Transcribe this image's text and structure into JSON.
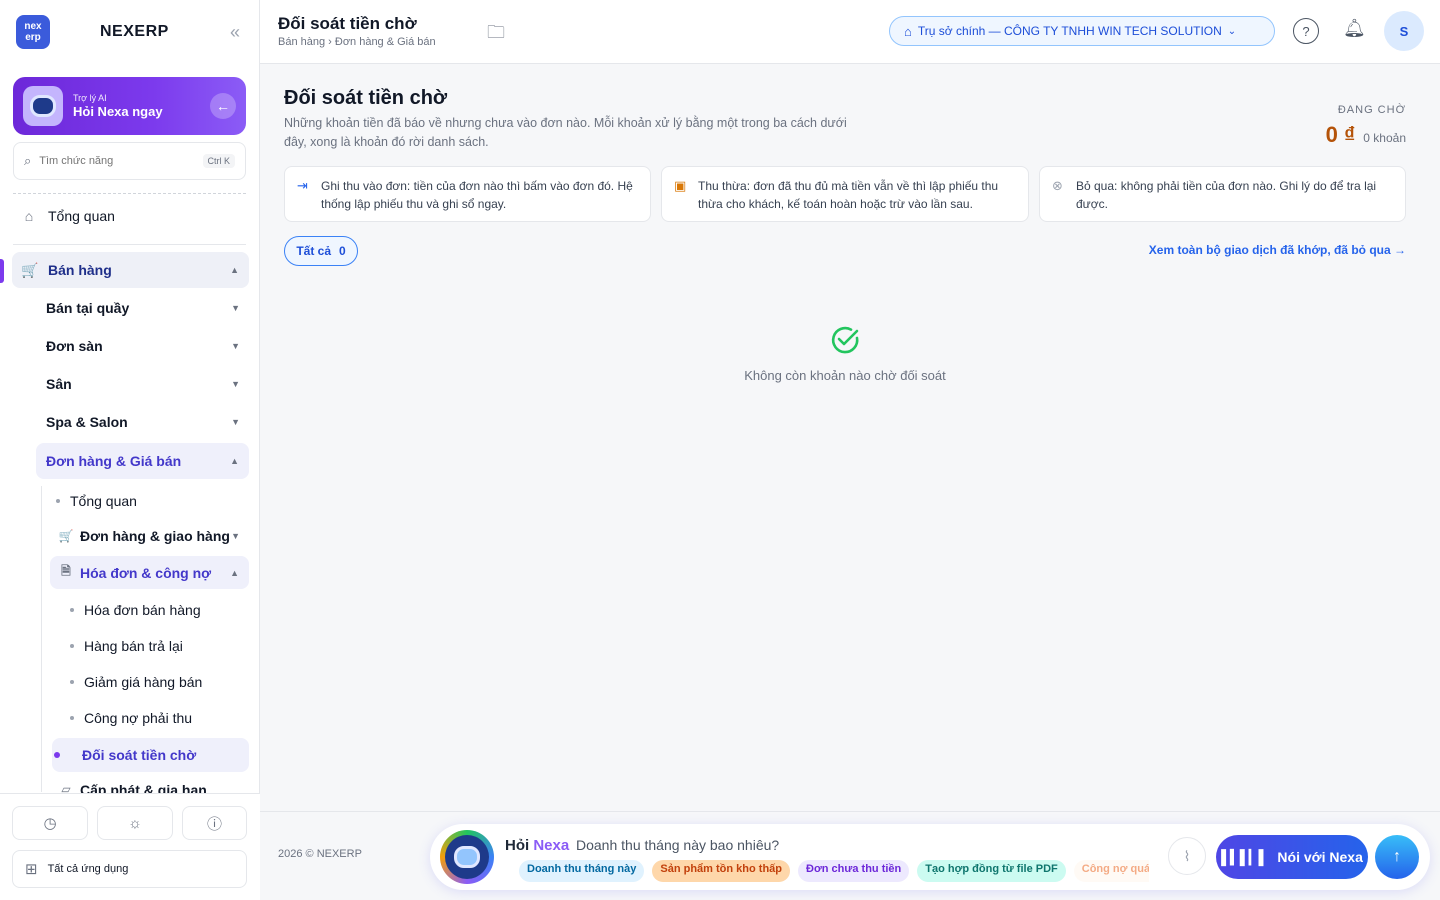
{
  "brand": {
    "logo_top": "nex",
    "logo_bottom": "erp",
    "name": "NEXERP",
    "collapse_icon": "«"
  },
  "ai_card": {
    "subtitle": "Trợ lý AI",
    "title": "Hỏi Nexa ngay",
    "arrow": "←"
  },
  "search": {
    "placeholder": "Tìm chức năng",
    "shortcut": "Ctrl K"
  },
  "sidebar": {
    "overview": "Tổng quan",
    "sales": "Bán hàng",
    "pos": "Bán tại quầy",
    "marketplace_orders": "Đơn sàn",
    "courts": "Sân",
    "spa": "Spa & Salon",
    "orders_pricing": "Đơn hàng & Giá bán",
    "sub_overview": "Tổng quan",
    "orders_delivery": "Đơn hàng & giao hàng",
    "invoices_debts": "Hóa đơn & công nợ",
    "sales_invoice": "Hóa đơn bán hàng",
    "returns": "Hàng bán trả lại",
    "sales_discount": "Giảm giá hàng bán",
    "receivables": "Công nợ phải thu",
    "pending_reconcile": "Đối soát tiền chờ",
    "grant_renew": "Cấp phát & gia hạn"
  },
  "sidebar_footer": {
    "all_apps": "Tất cả ứng dụng"
  },
  "header": {
    "title": "Đối soát tiền chờ",
    "breadcrumb": "Bán hàng › Đơn hàng & Giá bán",
    "branch": "Trụ sở chính — CÔNG TY TNHH WIN TECH SOLUTION",
    "help": "?",
    "avatar": "S"
  },
  "main": {
    "title": "Đối soát tiền chờ",
    "description": "Những khoản tiền đã báo về nhưng chưa vào đơn nào. Mỗi khoản xử lý bằng một trong ba cách dưới đây, xong là khoản đó rời danh sách.",
    "pending_label": "ĐANG CHỜ",
    "pending_amount": "0 ₫",
    "pending_count": "0 khoản",
    "cards": [
      {
        "text": "Ghi thu vào đơn: tiền của đơn nào thì bấm vào đơn đó. Hệ thống lập phiếu thu và ghi sổ ngay.",
        "color": "#2563eb"
      },
      {
        "text": "Thu thừa: đơn đã thu đủ mà tiền vẫn về thì lập phiếu thu thừa cho khách, kế toán hoàn hoặc trừ vào lần sau.",
        "color": "#d97706"
      },
      {
        "text": "Bỏ qua: không phải tiền của đơn nào. Ghi lý do để tra lại được.",
        "color": "#9ca3af"
      }
    ],
    "filter_all": "Tất cả",
    "filter_count": "0",
    "see_all": "Xem toàn bộ giao dịch đã khớp, đã bỏ qua →",
    "empty_text": "Không còn khoản nào chờ đối soát"
  },
  "footer": {
    "copyright": "2026 © NEXERP",
    "ask_prefix": "Hỏi",
    "ask_name": "Nexa",
    "input_value": "Doanh thu tháng này bao nhiêu?",
    "chips": [
      "Doanh thu tháng này",
      "Sản phẩm tồn kho thấp",
      "Đơn chưa thu tiền",
      "Tạo hợp đồng từ file PDF",
      "Công nợ quá hạn"
    ],
    "voice_label": "Nói với Nexa"
  }
}
